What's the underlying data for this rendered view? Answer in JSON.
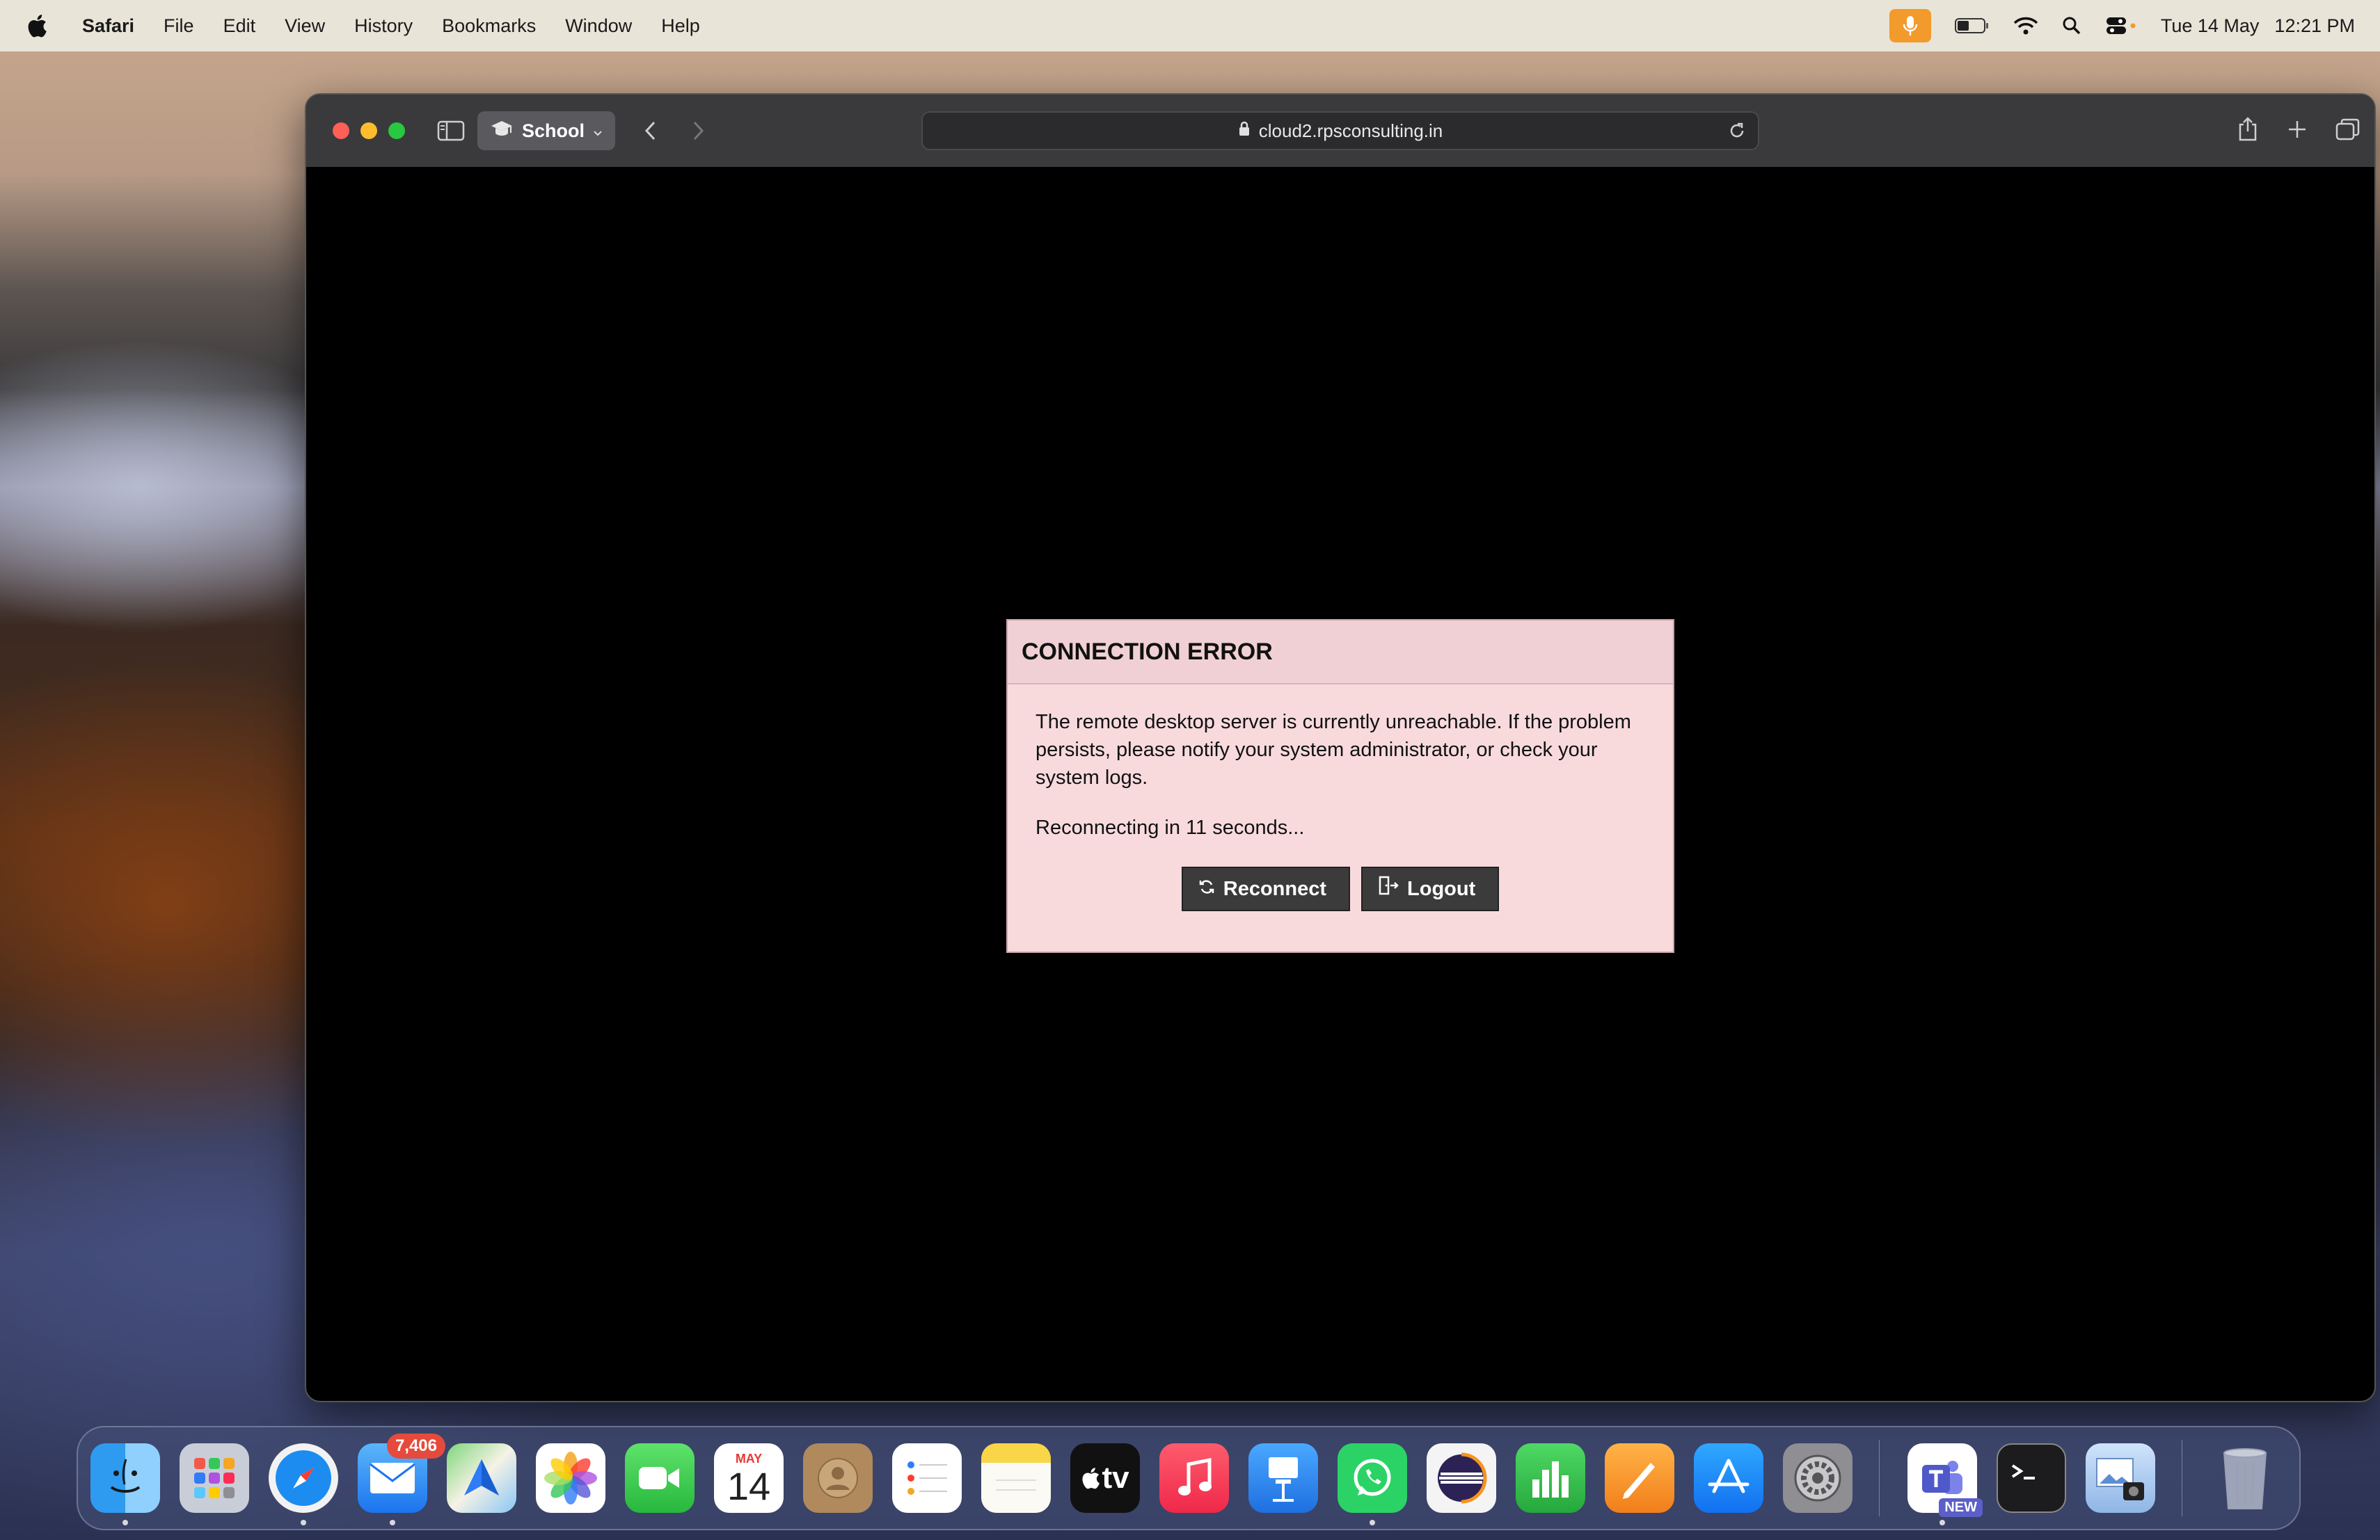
{
  "menubar": {
    "app_name": "Safari",
    "items": [
      "File",
      "Edit",
      "View",
      "History",
      "Bookmarks",
      "Window",
      "Help"
    ],
    "date": "Tue 14 May",
    "time": "12:21 PM"
  },
  "browser": {
    "profile": "School",
    "url": "cloud2.rpsconsulting.in"
  },
  "dialog": {
    "title": "CONNECTION ERROR",
    "message": "The remote desktop server is currently unreachable. If the problem persists, please notify your system administrator, or check your system logs.",
    "status": "Reconnecting in 11 seconds...",
    "reconnect_label": "Reconnect",
    "logout_label": "Logout"
  },
  "dock": {
    "mail_badge": "7,406",
    "calendar_month": "MAY",
    "calendar_day": "14",
    "tv_label": "tv",
    "teams_badge": "NEW"
  },
  "colors": {
    "dialog_bg": "#f8dadd",
    "button_bg": "#3b3b3b",
    "mic_accent": "#f39a2c"
  }
}
